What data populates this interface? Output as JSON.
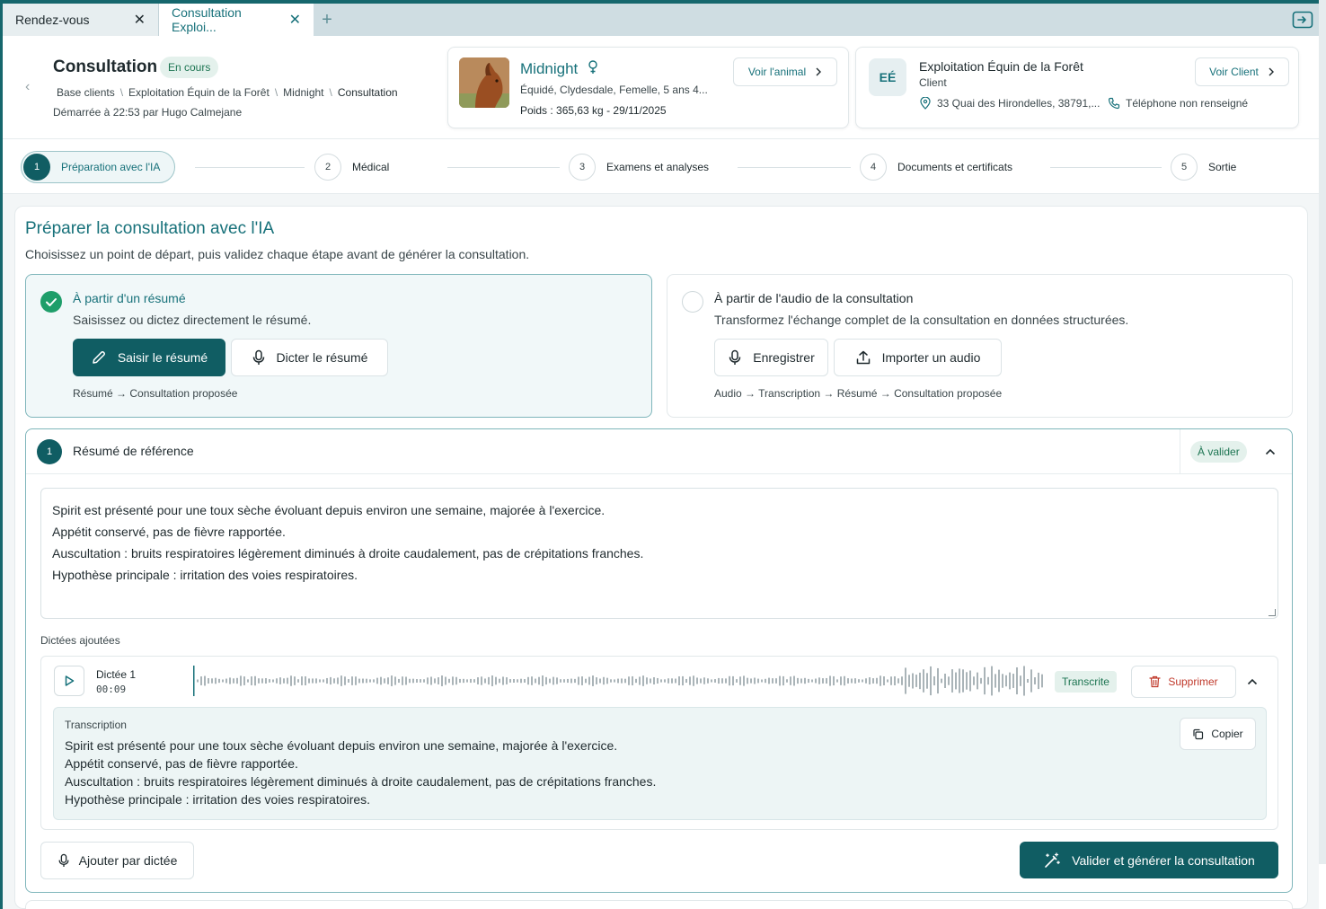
{
  "tabs": [
    {
      "label": "Rendez-vous",
      "close": "✕"
    },
    {
      "label": "Consultation Exploi...",
      "close": "✕"
    }
  ],
  "tab_add": "+",
  "header": {
    "title": "Consultation",
    "status": "En cours",
    "breadcrumb": [
      "Base clients",
      "Exploitation Équin de la Forêt",
      "Midnight",
      "Consultation"
    ],
    "breadcrumb_sep": "\\",
    "started": "Démarrée à 22:53 par Hugo Calmejane"
  },
  "animal": {
    "name": "Midnight",
    "description": "Équidé, Clydesdale, Femelle, 5 ans 4...",
    "weight": "Poids : 365,63 kg - 29/11/2025",
    "view_button": "Voir l'animal"
  },
  "client": {
    "initials": "EÉ",
    "name": "Exploitation Équin de la Forêt",
    "role": "Client",
    "address": "33 Quai des Hirondelles, 38791,...",
    "phone": "Téléphone non renseigné",
    "view_button": "Voir Client"
  },
  "steps": [
    {
      "num": "1",
      "label": "Préparation avec l'IA"
    },
    {
      "num": "2",
      "label": "Médical"
    },
    {
      "num": "3",
      "label": "Examens et analyses"
    },
    {
      "num": "4",
      "label": "Documents et certificats"
    },
    {
      "num": "5",
      "label": "Sortie"
    }
  ],
  "active_step": 1,
  "panel": {
    "title": "Préparer la consultation avec l'IA",
    "subtitle": "Choisissez un point de départ, puis validez chaque étape avant de générer la consultation."
  },
  "options": {
    "summary": {
      "title": "À partir d'un résumé",
      "description": "Saisissez ou dictez directement le résumé.",
      "primary_button": "Saisir le résumé",
      "secondary_button": "Dicter le résumé",
      "flow": "Résumé → Consultation proposée",
      "selected": true
    },
    "audio": {
      "title": "À partir de l'audio de la consultation",
      "description": "Transformez l'échange complet de la consultation en données structurées.",
      "record_button": "Enregistrer",
      "import_button": "Importer un audio",
      "flow": "Audio → Transcription → Résumé → Consultation proposée",
      "selected": false
    }
  },
  "resume": {
    "num": "1",
    "title": "Résumé de référence",
    "status": "À valider",
    "text_lines": [
      "Spirit est présenté pour une toux sèche évoluant depuis environ une semaine, majorée à l'exercice.",
      "Appétit conservé, pas de fièvre rapportée.",
      "Auscultation : bruits respiratoires légèrement diminués à droite caudalement, pas de crépitations franches.",
      "Hypothèse principale : irritation des voies respiratoires."
    ],
    "dictations_label": "Dictées ajoutées",
    "dictation": {
      "name": "Dictée 1",
      "duration": "00:09",
      "status": "Transcrite",
      "delete_button": "Supprimer",
      "transcription_label": "Transcription",
      "copy_button": "Copier",
      "transcription_lines": [
        "Spirit est présenté pour une toux sèche évoluant depuis environ une semaine, majorée à l'exercice.",
        "Appétit conservé, pas de fièvre rapportée.",
        "Auscultation : bruits respiratoires légèrement diminués à droite caudalement, pas de crépitations franches.",
        "Hypothèse principale : irritation des voies respiratoires."
      ]
    },
    "add_dictation_button": "Ajouter par dictée",
    "generate_button": "Valider et générer la consultation"
  },
  "colors": {
    "brand": "#105d63",
    "accent": "#17717a",
    "success": "#1d7552",
    "danger": "#c0392b",
    "check": "#1e9e6a"
  }
}
